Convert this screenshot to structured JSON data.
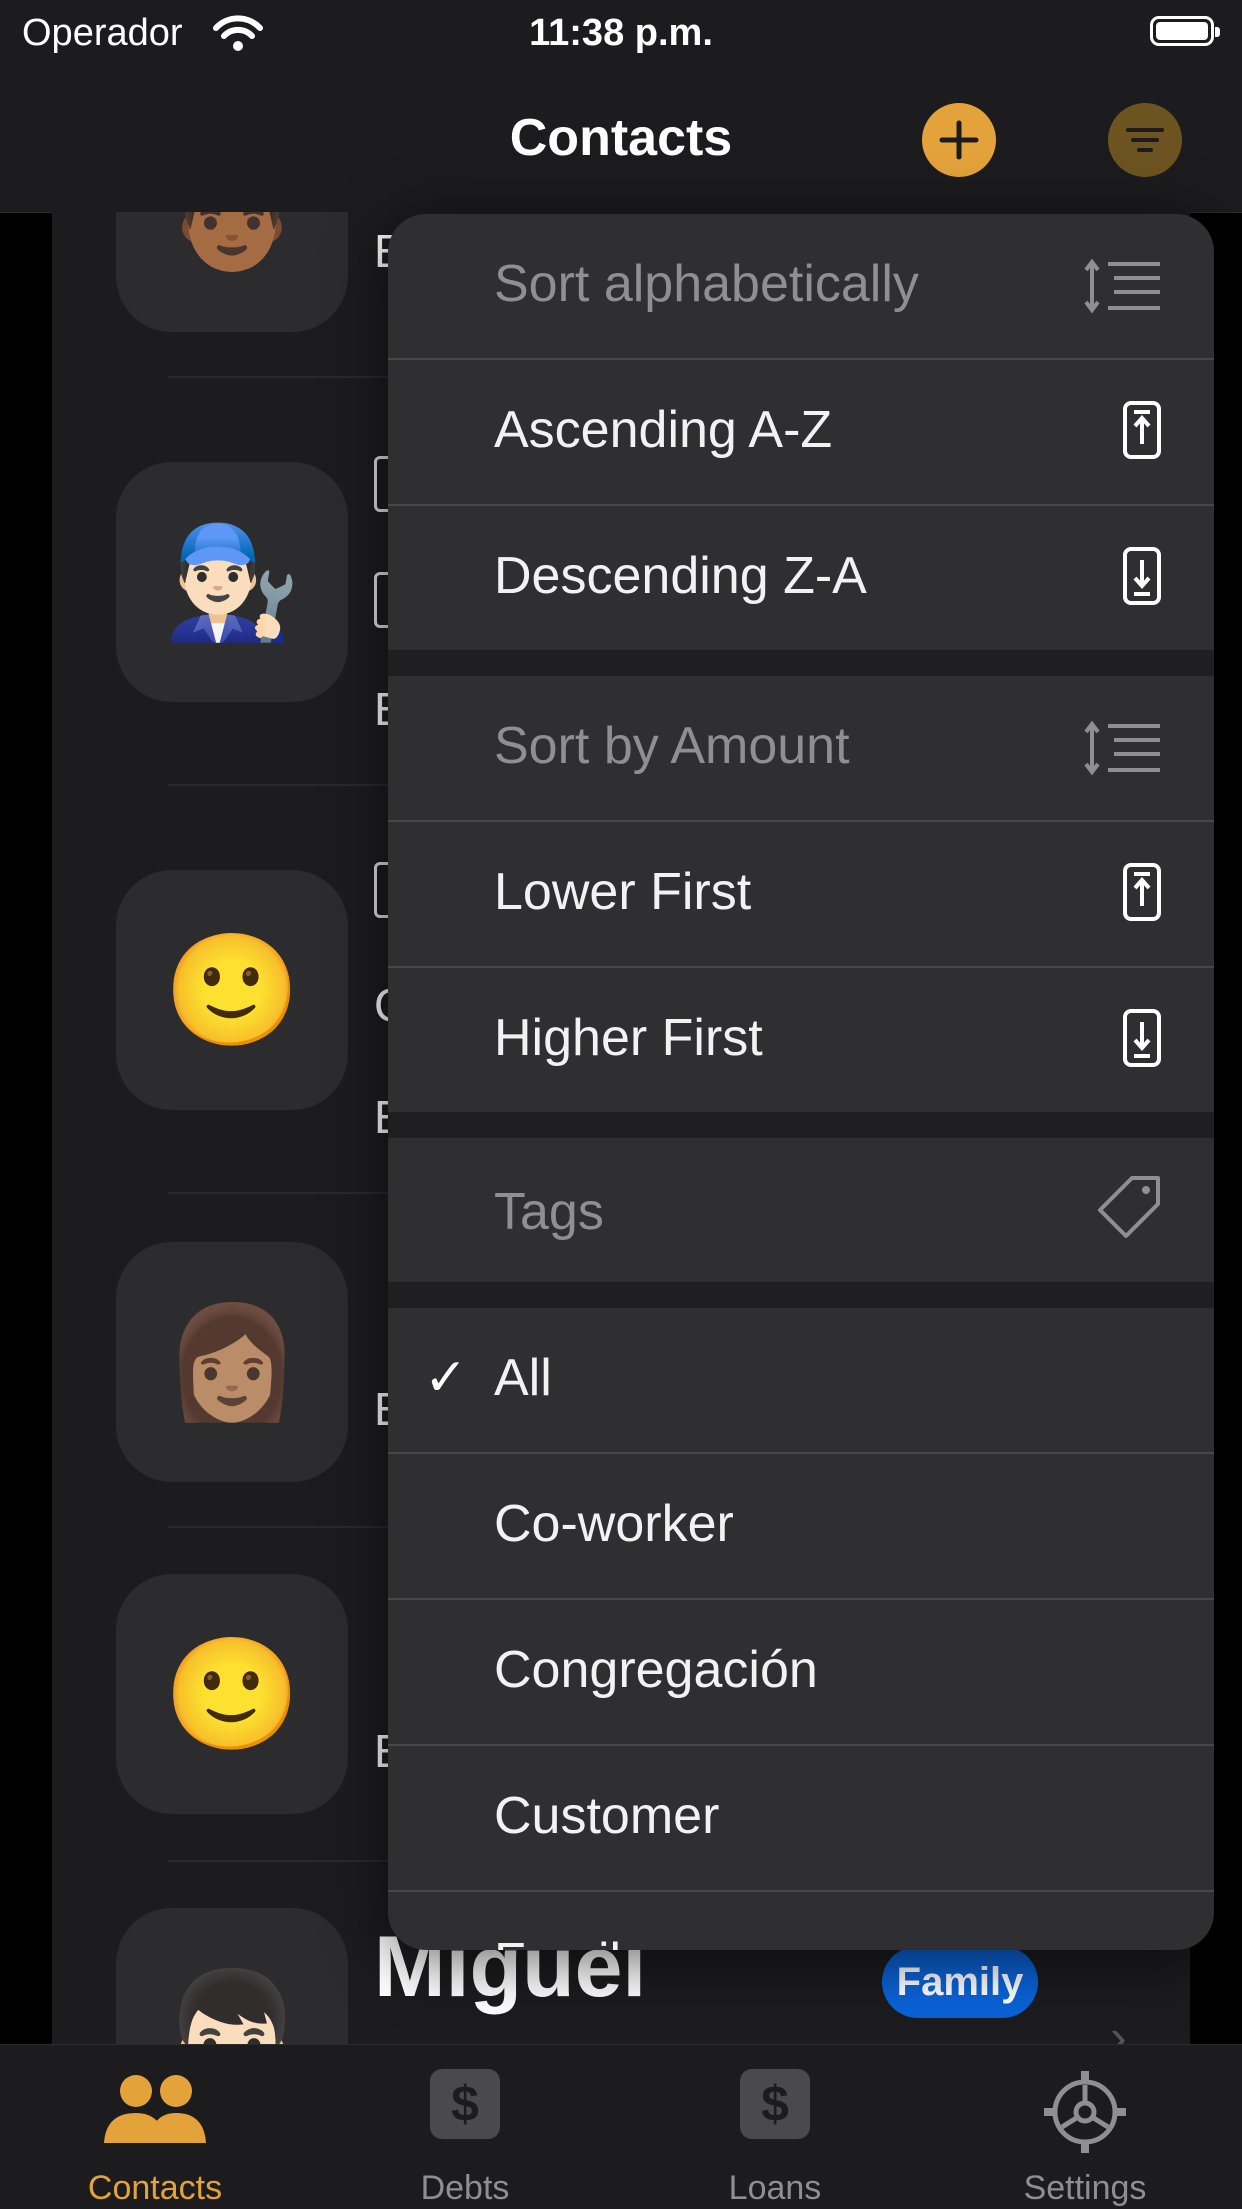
{
  "status_bar": {
    "carrier": "Operador",
    "time": "11:38 p.m."
  },
  "nav": {
    "title": "Contacts",
    "add_icon": "plus-circle-icon",
    "filter_icon": "filter-lines-icon"
  },
  "list": {
    "visible_name": "Miguel",
    "visible_tag": "Family",
    "avatars": [
      "👨🏾",
      "👨🏻‍🔧",
      "🙂",
      "👩🏽",
      "🙂",
      "👦🏻"
    ]
  },
  "menu": {
    "sections": [
      {
        "header": "Sort alphabetically",
        "items": [
          "Ascending A-Z",
          "Descending Z-A"
        ]
      },
      {
        "header": "Sort by Amount",
        "items": [
          "Lower First",
          "Higher First"
        ]
      },
      {
        "header": "Tags",
        "items": [
          "All",
          "Co-worker",
          "Congregación",
          "Customer",
          "Family"
        ]
      }
    ],
    "selected_tag": "All"
  },
  "tabs": [
    {
      "label": "Contacts",
      "icon": "people-icon",
      "active": true
    },
    {
      "label": "Debts",
      "icon": "dollar-icon",
      "active": false
    },
    {
      "label": "Loans",
      "icon": "dollar-icon",
      "active": false
    },
    {
      "label": "Settings",
      "icon": "gear-icon",
      "active": false
    }
  ],
  "colors": {
    "accent": "#e3a23a",
    "badge_blue": "#0a63d8",
    "menu_bg": "#2f2f31"
  }
}
